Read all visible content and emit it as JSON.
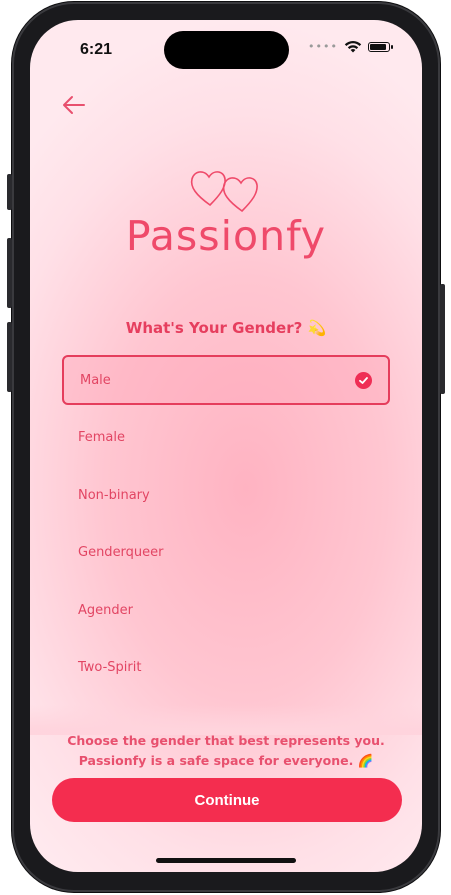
{
  "status_bar": {
    "time": "6:21",
    "cellular_icon": "cellular-dots-icon",
    "wifi_icon": "wifi-icon",
    "battery_icon": "battery-icon"
  },
  "header": {
    "back_icon": "arrow-left-icon"
  },
  "brand": {
    "name": "Passionfy",
    "logo_icon": "double-heart-logo"
  },
  "question": {
    "text": "What's Your Gender? 💫"
  },
  "options": [
    {
      "label": "Male",
      "selected": true
    },
    {
      "label": "Female",
      "selected": false
    },
    {
      "label": "Non-binary",
      "selected": false
    },
    {
      "label": "Genderqueer",
      "selected": false
    },
    {
      "label": "Agender",
      "selected": false
    },
    {
      "label": "Two-Spirit",
      "selected": false
    }
  ],
  "note": {
    "line1": "Choose the gender that best represents you.",
    "line2": "Passionfy is a safe space for everyone. 🌈"
  },
  "continue_label": "Continue",
  "colors": {
    "accent": "#f42d4f",
    "text_pink": "#e24563",
    "background": "#ffc6d1"
  }
}
